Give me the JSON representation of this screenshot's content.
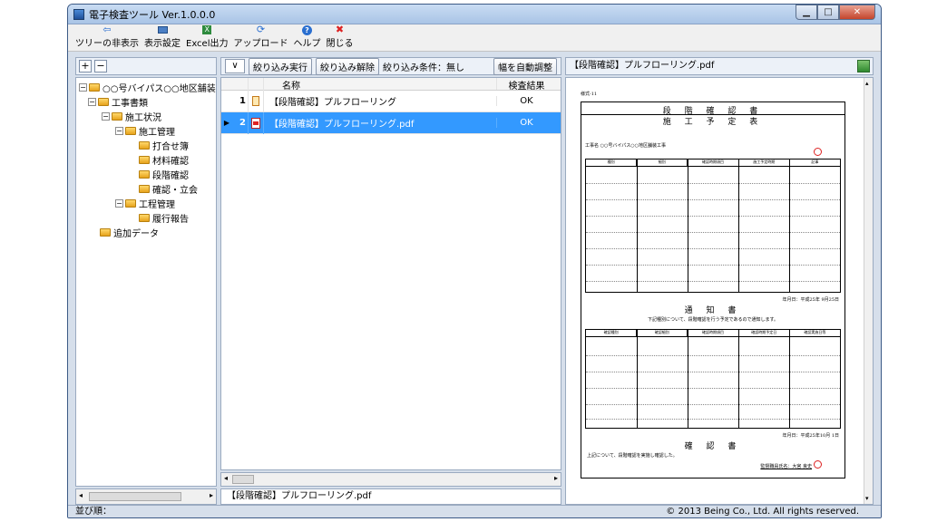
{
  "window": {
    "title": "電子検査ツール  Ver.1.0.0.0"
  },
  "toolbar": {
    "items": [
      {
        "label": "ツリーの非表示",
        "icon": "back-arrow-icon"
      },
      {
        "label": "表示設定",
        "icon": "monitor-icon"
      },
      {
        "label": "Excel出力",
        "icon": "excel-icon"
      },
      {
        "label": "アップロード",
        "icon": "upload-icon"
      },
      {
        "label": "ヘルプ",
        "icon": "help-icon"
      },
      {
        "label": "閉じる",
        "icon": "close-x-icon"
      }
    ]
  },
  "tree": {
    "expand_label": "+",
    "collapse_label": "−",
    "nodes": [
      {
        "label": "○○号バイパス○○地区舗装",
        "level": 0
      },
      {
        "label": "工事書類",
        "level": 1
      },
      {
        "label": "施工状況",
        "level": 2
      },
      {
        "label": "施工管理",
        "level": 3
      },
      {
        "label": "打合せ簿",
        "level": 4
      },
      {
        "label": "材料確認",
        "level": 4
      },
      {
        "label": "段階確認",
        "level": 4
      },
      {
        "label": "確認・立会",
        "level": 4
      },
      {
        "label": "工程管理",
        "level": 3
      },
      {
        "label": "履行報告",
        "level": 4
      },
      {
        "label": "追加データ",
        "level": 1
      }
    ]
  },
  "grid": {
    "run_filter": "絞り込み実行",
    "clear_filter": "絞り込み解除",
    "filter_condition": "絞り込み条件：無し",
    "autofit": "幅を自動調整",
    "col_name": "名称",
    "col_result": "検査結果",
    "rows": [
      {
        "num": "1",
        "name": "【段階確認】プルフローリング",
        "result": "OK",
        "selected": false,
        "icon": "clipboard-icon"
      },
      {
        "num": "2",
        "name": "【段階確認】プルフローリング.pdf",
        "result": "OK",
        "selected": true,
        "icon": "pdf-icon"
      }
    ],
    "status_file": "【段階確認】プルフローリング.pdf"
  },
  "preview": {
    "title": "【段階確認】プルフローリング.pdf",
    "doc": {
      "form_no": "様式-11",
      "header": "段 階 確 認 書",
      "sub1": "施 工 予 定 表",
      "sub2": "通 知 書",
      "sub3": "確 認 書",
      "date1": "年月日：平成25年 9月25日",
      "date2": "年月日：平成25年10月 1日",
      "project": "工事名  ○○号バイパス○○地区舗装工事",
      "notice": "下記種別について、段階確認を行う予定であるので通知します。",
      "confirm": "上記について、段階確認を実施し確認した。",
      "supervisor": "監督職員氏名：大宮 良史",
      "cols1": [
        "種別",
        "細別",
        "確認時期項目",
        "施工予定時期",
        "記事"
      ],
      "cols2": [
        "確認種別",
        "確認細別",
        "確認時期項目",
        "確認時期予定日",
        "確認実施日等"
      ]
    }
  },
  "statusbar": {
    "left": "並び順：",
    "right": "© 2013 Being Co., Ltd. All rights reserved."
  }
}
